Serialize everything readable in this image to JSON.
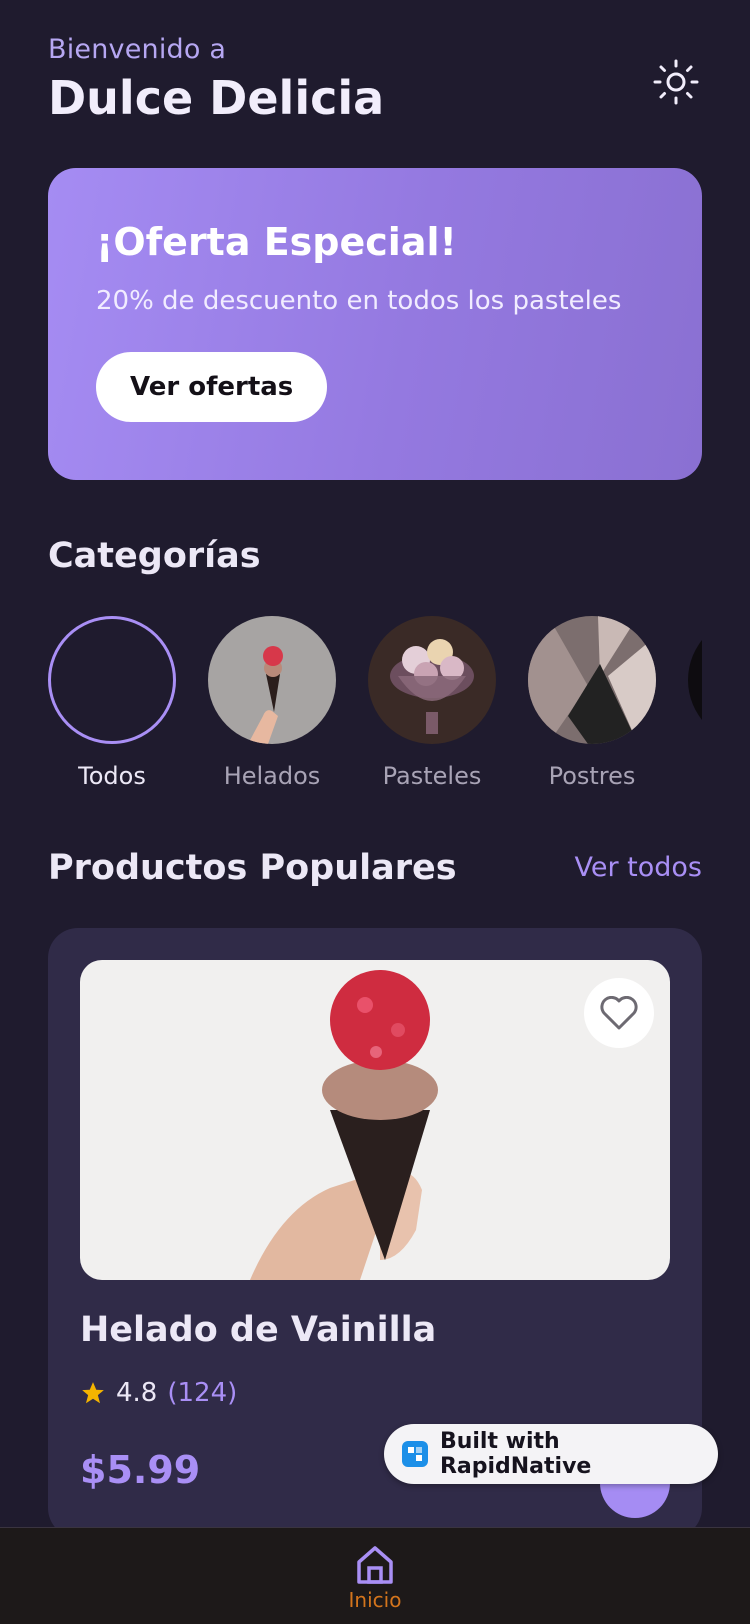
{
  "header": {
    "welcome": "Bienvenido a",
    "title": "Dulce Delicia",
    "theme_icon": "sun-icon"
  },
  "promo": {
    "title": "¡Oferta Especial!",
    "subtitle": "20% de descuento en todos los pasteles",
    "button": "Ver ofertas"
  },
  "categories": {
    "title": "Categorías",
    "items": [
      {
        "label": "Todos",
        "active": true
      },
      {
        "label": "Helados",
        "active": false
      },
      {
        "label": "Pasteles",
        "active": false
      },
      {
        "label": "Postres",
        "active": false
      }
    ]
  },
  "popular": {
    "title": "Productos Populares",
    "see_all": "Ver todos",
    "product": {
      "name": "Helado de Vainilla",
      "rating": "4.8",
      "reviews": "(124)",
      "price": "$5.99"
    }
  },
  "badge": {
    "text": "Built with RapidNative"
  },
  "tabbar": {
    "home_label": "Inicio"
  },
  "colors": {
    "background": "#1f1b2e",
    "accent": "#a98ff5",
    "card": "#302b48",
    "tab_active": "#d3741c"
  }
}
